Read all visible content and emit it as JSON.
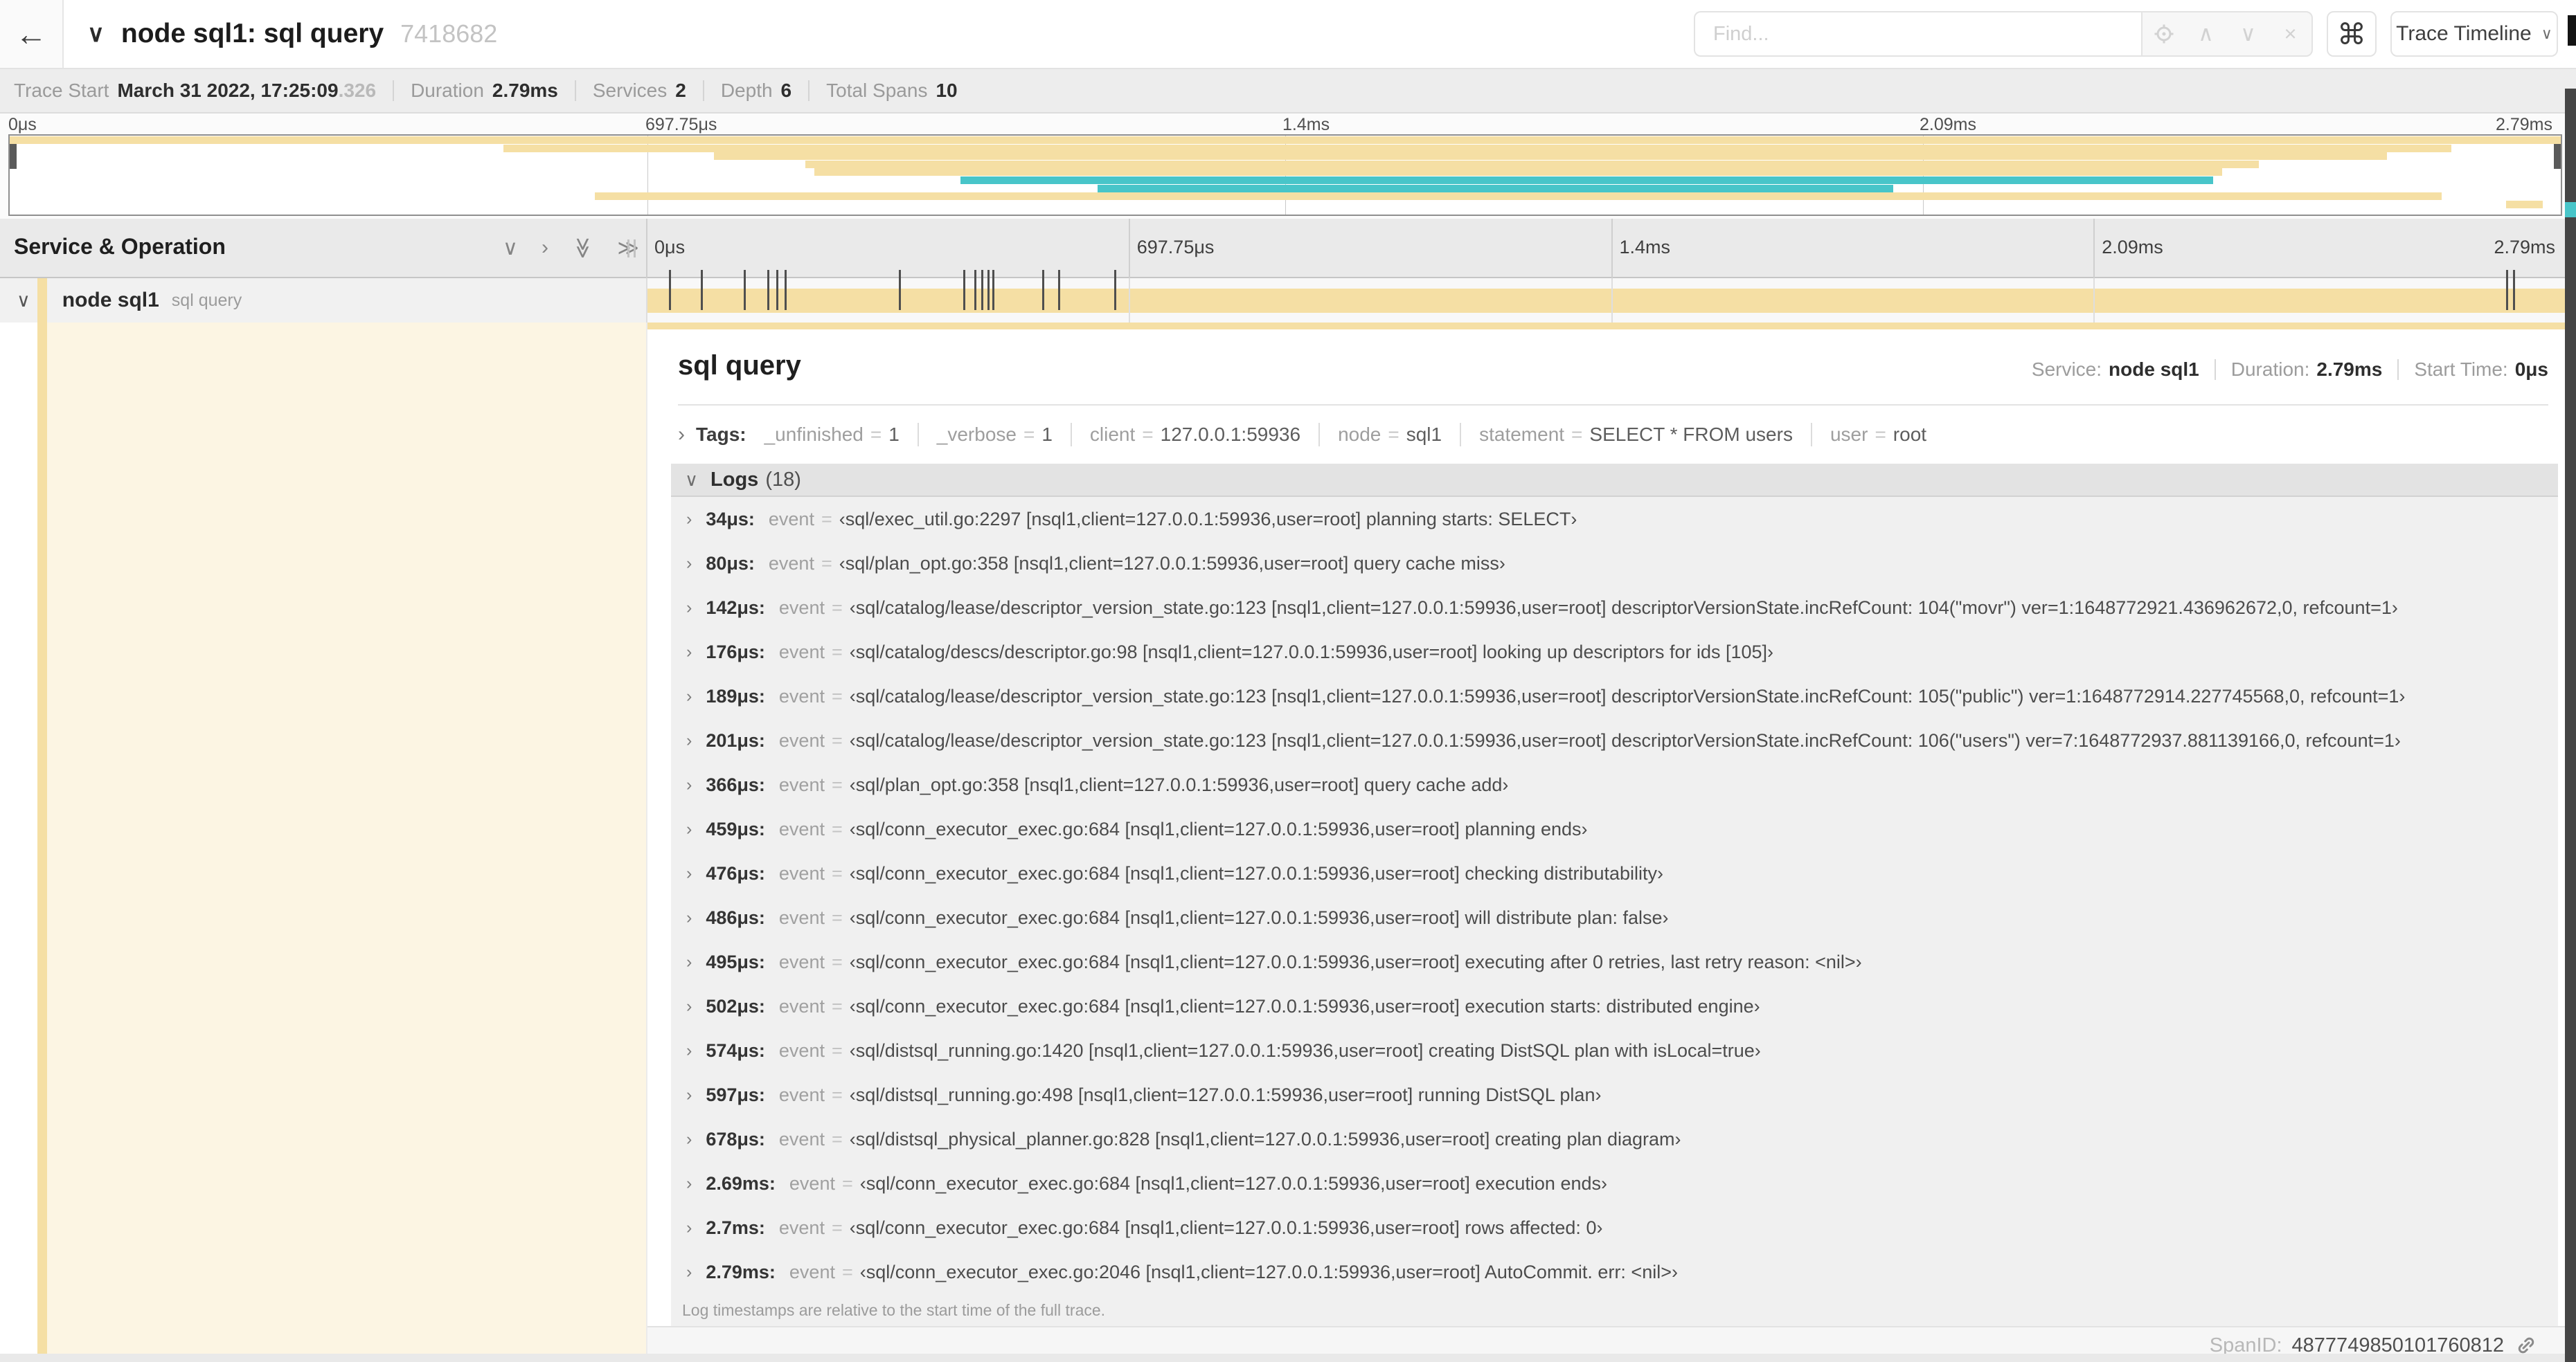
{
  "colors": {
    "tan": "#f5dfa4",
    "teal": "#48c5c9",
    "cream": "#fcf5e3"
  },
  "header": {
    "back_icon": "←",
    "collapse_icon": "∨",
    "title": "node sql1: sql query",
    "trace_id": "7418682",
    "find_placeholder": "Find...",
    "find_tools": {
      "prev": "∧",
      "next": "∨",
      "clear": "×"
    },
    "shortcut": "⌘",
    "view_select": "Trace Timeline",
    "view_caret": "∨"
  },
  "trace_info": {
    "items": [
      {
        "label": "Trace Start",
        "value": "March 31 2022, 17:25:09",
        "suffix": ".326"
      },
      {
        "label": "Duration",
        "value": "2.79ms",
        "suffix": ""
      },
      {
        "label": "Services",
        "value": "2",
        "suffix": ""
      },
      {
        "label": "Depth",
        "value": "6",
        "suffix": ""
      },
      {
        "label": "Total Spans",
        "value": "10",
        "suffix": ""
      }
    ]
  },
  "minimap": {
    "duration_ms": 2.79,
    "axis_labels": [
      {
        "text": "0μs",
        "pos": 0
      },
      {
        "text": "697.75μs",
        "pos": 25
      },
      {
        "text": "1.4ms",
        "pos": 50
      },
      {
        "text": "2.09ms",
        "pos": 75
      },
      {
        "text": "2.79ms",
        "pos": 100
      }
    ],
    "spans": [
      {
        "row": 0,
        "start": 0,
        "end": 2.79,
        "color": "tan"
      },
      {
        "row": 1,
        "start": 0.54,
        "end": 2.67,
        "color": "tan"
      },
      {
        "row": 2,
        "start": 0.77,
        "end": 2.6,
        "color": "tan"
      },
      {
        "row": 3,
        "start": 0.87,
        "end": 2.46,
        "color": "tan"
      },
      {
        "row": 4,
        "start": 0.88,
        "end": 2.42,
        "color": "tan"
      },
      {
        "row": 5,
        "start": 1.04,
        "end": 2.41,
        "color": "teal"
      },
      {
        "row": 6,
        "start": 1.19,
        "end": 2.06,
        "color": "teal"
      },
      {
        "row": 7,
        "start": 0.64,
        "end": 2.66,
        "color": "tan"
      },
      {
        "row": 8,
        "start": 2.73,
        "end": 2.77,
        "color": "tan"
      }
    ]
  },
  "timeline": {
    "column_title": "Service & Operation",
    "tool_icons": [
      {
        "name": "collapse-one-icon",
        "glyph": "∨",
        "rotate": false
      },
      {
        "name": "expand-one-icon",
        "glyph": "›",
        "rotate": false
      },
      {
        "name": "collapse-all-icon",
        "glyph": "≫",
        "rotate": true
      },
      {
        "name": "expand-all-icon",
        "glyph": "≫",
        "rotate": false
      }
    ],
    "ticks": [
      {
        "text": "0μs",
        "pos": 0
      },
      {
        "text": "697.75μs",
        "pos": 25
      },
      {
        "text": "1.4ms",
        "pos": 50
      },
      {
        "text": "2.09ms",
        "pos": 75
      },
      {
        "text": "2.79ms",
        "pos": 100
      }
    ]
  },
  "span_row": {
    "toggle_icon": "∨",
    "service": "node sql1",
    "operation": "sql query",
    "total_us": 2790,
    "event_ticks_us": [
      34,
      80,
      142,
      176,
      189,
      201,
      366,
      459,
      476,
      486,
      495,
      502,
      574,
      597,
      678,
      2690,
      2700,
      2790
    ]
  },
  "detail": {
    "operation": "sql query",
    "stats": [
      {
        "label": "Service:",
        "value": "node sql1"
      },
      {
        "label": "Duration:",
        "value": "2.79ms"
      },
      {
        "label": "Start Time:",
        "value": "0μs"
      }
    ],
    "tags_toggle": "›",
    "tags_label": "Tags:",
    "tags": [
      {
        "key": "_unfinished",
        "value": "1"
      },
      {
        "key": "_verbose",
        "value": "1"
      },
      {
        "key": "client",
        "value": "127.0.0.1:59936"
      },
      {
        "key": "node",
        "value": "sql1"
      },
      {
        "key": "statement",
        "value": "SELECT * FROM users"
      },
      {
        "key": "user",
        "value": "root"
      }
    ],
    "logs_toggle": "∨",
    "logs_label": "Logs",
    "logs_count": "(18)",
    "log_field": "event",
    "logs": [
      {
        "time": "34μs:",
        "value": "‹sql/exec_util.go:2297 [nsql1,client=127.0.0.1:59936,user=root] planning starts: SELECT›"
      },
      {
        "time": "80μs:",
        "value": "‹sql/plan_opt.go:358 [nsql1,client=127.0.0.1:59936,user=root] query cache miss›"
      },
      {
        "time": "142μs:",
        "value": "‹sql/catalog/lease/descriptor_version_state.go:123 [nsql1,client=127.0.0.1:59936,user=root] descriptorVersionState.incRefCount: 104(\"movr\") ver=1:1648772921.436962672,0, refcount=1›"
      },
      {
        "time": "176μs:",
        "value": "‹sql/catalog/descs/descriptor.go:98 [nsql1,client=127.0.0.1:59936,user=root] looking up descriptors for ids [105]›"
      },
      {
        "time": "189μs:",
        "value": "‹sql/catalog/lease/descriptor_version_state.go:123 [nsql1,client=127.0.0.1:59936,user=root] descriptorVersionState.incRefCount: 105(\"public\") ver=1:1648772914.227745568,0, refcount=1›"
      },
      {
        "time": "201μs:",
        "value": "‹sql/catalog/lease/descriptor_version_state.go:123 [nsql1,client=127.0.0.1:59936,user=root] descriptorVersionState.incRefCount: 106(\"users\") ver=7:1648772937.881139166,0, refcount=1›"
      },
      {
        "time": "366μs:",
        "value": "‹sql/plan_opt.go:358 [nsql1,client=127.0.0.1:59936,user=root] query cache add›"
      },
      {
        "time": "459μs:",
        "value": "‹sql/conn_executor_exec.go:684 [nsql1,client=127.0.0.1:59936,user=root] planning ends›"
      },
      {
        "time": "476μs:",
        "value": "‹sql/conn_executor_exec.go:684 [nsql1,client=127.0.0.1:59936,user=root] checking distributability›"
      },
      {
        "time": "486μs:",
        "value": "‹sql/conn_executor_exec.go:684 [nsql1,client=127.0.0.1:59936,user=root] will distribute plan: false›"
      },
      {
        "time": "495μs:",
        "value": "‹sql/conn_executor_exec.go:684 [nsql1,client=127.0.0.1:59936,user=root] executing after 0 retries, last retry reason: <nil>›"
      },
      {
        "time": "502μs:",
        "value": "‹sql/conn_executor_exec.go:684 [nsql1,client=127.0.0.1:59936,user=root] execution starts: distributed engine›"
      },
      {
        "time": "574μs:",
        "value": "‹sql/distsql_running.go:1420 [nsql1,client=127.0.0.1:59936,user=root] creating DistSQL plan with isLocal=true›"
      },
      {
        "time": "597μs:",
        "value": "‹sql/distsql_running.go:498 [nsql1,client=127.0.0.1:59936,user=root] running DistSQL plan›"
      },
      {
        "time": "678μs:",
        "value": "‹sql/distsql_physical_planner.go:828 [nsql1,client=127.0.0.1:59936,user=root] creating plan diagram›"
      },
      {
        "time": "2.69ms:",
        "value": "‹sql/conn_executor_exec.go:684 [nsql1,client=127.0.0.1:59936,user=root] execution ends›"
      },
      {
        "time": "2.7ms:",
        "value": "‹sql/conn_executor_exec.go:684 [nsql1,client=127.0.0.1:59936,user=root] rows affected: 0›"
      },
      {
        "time": "2.79ms:",
        "value": "‹sql/conn_executor_exec.go:2046 [nsql1,client=127.0.0.1:59936,user=root] AutoCommit. err: <nil>›"
      }
    ],
    "logs_note": "Log timestamps are relative to the start time of the full trace.",
    "spanid_label": "SpanID:",
    "spanid": "4877749850101760812"
  }
}
